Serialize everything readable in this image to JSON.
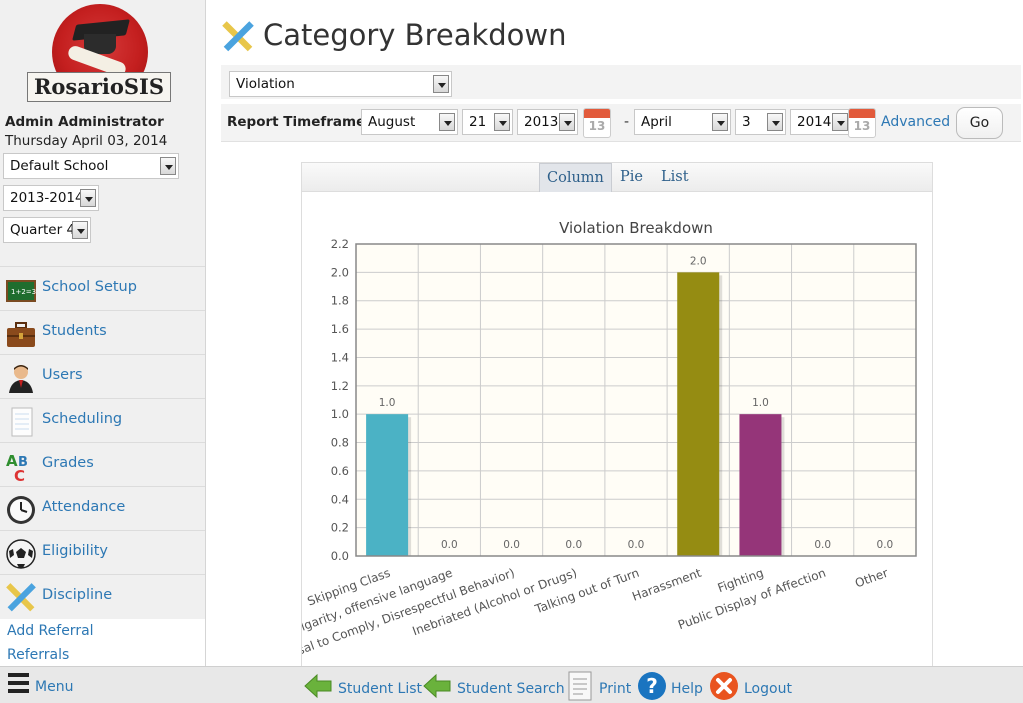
{
  "sidebar": {
    "logo_text": "RosarioSIS",
    "user_name": "Admin Administrator",
    "date": "Thursday April 03, 2014",
    "school_select": "Default School",
    "year_select": "2013-2014",
    "quarter_select": "Quarter 4",
    "menu": [
      {
        "label": "School Setup",
        "icon": "chalkboard-icon"
      },
      {
        "label": "Students",
        "icon": "briefcase-icon"
      },
      {
        "label": "Users",
        "icon": "user-icon"
      },
      {
        "label": "Scheduling",
        "icon": "notepad-icon"
      },
      {
        "label": "Grades",
        "icon": "abc-icon"
      },
      {
        "label": "Attendance",
        "icon": "clock-icon"
      },
      {
        "label": "Eligibility",
        "icon": "soccer-ball-icon"
      },
      {
        "label": "Discipline",
        "icon": "pencil-ruler-icon"
      }
    ],
    "submenu": [
      "Add Referral",
      "Referrals"
    ]
  },
  "main": {
    "title": "Category Breakdown",
    "category_select": "Violation",
    "timeframe": {
      "label": "Report Timeframe:",
      "start_month": "August",
      "start_day": "21",
      "start_year": "2013",
      "end_month": "April",
      "end_day": "3",
      "end_year": "2014",
      "calendar_day": "13",
      "dash": "-",
      "advanced_label": "Advanced",
      "go_label": "Go"
    },
    "chart_tabs": [
      {
        "label": "Column",
        "active": true
      },
      {
        "label": "Pie",
        "active": false
      },
      {
        "label": "List",
        "active": false
      }
    ]
  },
  "chart_data": {
    "type": "bar",
    "title": "Violation Breakdown",
    "categories": [
      "Skipping Class",
      "Profanity, vulgarity, offensive language",
      "Insubordination (Refusal to Comply, Disrespectful Behavior)",
      "Inebriated (Alcohol or Drugs)",
      "Talking out of Turn",
      "Harassment",
      "Fighting",
      "Public Display of Affection",
      "Other"
    ],
    "values": [
      1.0,
      0.0,
      0.0,
      0.0,
      0.0,
      2.0,
      1.0,
      0.0,
      0.0
    ],
    "value_labels": [
      "1.0",
      "0.0",
      "0.0",
      "0.0",
      "0.0",
      "2.0",
      "1.0",
      "0.0",
      "0.0"
    ],
    "colors": [
      "#4bb2c5",
      "#c5b47f",
      "#eaa228",
      "#579575",
      "#839557",
      "#958c12",
      "#953579",
      "#4b5de4",
      "#d8b83f"
    ],
    "yticks": [
      "0.0",
      "0.2",
      "0.4",
      "0.6",
      "0.8",
      "1.0",
      "1.2",
      "1.4",
      "1.6",
      "1.8",
      "2.0",
      "2.2"
    ],
    "ylim": [
      0,
      2.2
    ],
    "grid": true
  },
  "footer": {
    "menu_label": "Menu",
    "items": [
      {
        "label": "Student List",
        "icon": "arrow-left-icon"
      },
      {
        "label": "Student Search",
        "icon": "arrow-left-icon"
      },
      {
        "label": "Print",
        "icon": "document-icon"
      },
      {
        "label": "Help",
        "icon": "help-icon"
      },
      {
        "label": "Logout",
        "icon": "logout-icon"
      }
    ]
  }
}
